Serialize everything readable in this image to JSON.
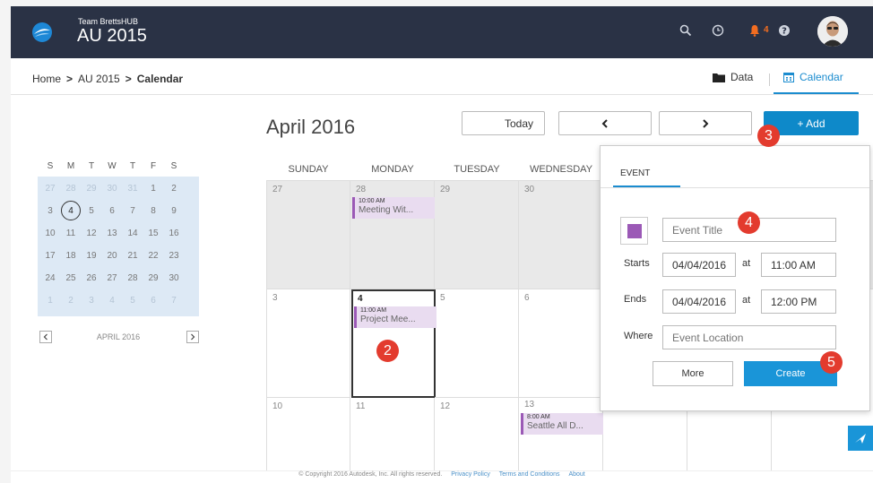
{
  "header": {
    "team": "Team BrettsHUB",
    "project": "AU 2015",
    "notification_count": "4"
  },
  "breadcrumb": {
    "items": [
      "Home",
      "AU 2015",
      "Calendar"
    ]
  },
  "view_tabs": [
    {
      "label": "Data",
      "active": false
    },
    {
      "label": "Calendar",
      "active": true
    }
  ],
  "calendar": {
    "month_title": "April 2016",
    "today_label": "Today",
    "add_label": "+ Add",
    "weekdays": [
      "SUNDAY",
      "MONDAY",
      "TUESDAY",
      "WEDNESDAY"
    ],
    "days": [
      "27",
      "28",
      "29",
      "30",
      "3",
      "4",
      "5",
      "6",
      "10",
      "11",
      "12",
      "13"
    ],
    "events": [
      {
        "time": "10:00 AM",
        "title": "Meeting Wit..."
      },
      {
        "time": "11:00 AM",
        "title": "Project Mee..."
      },
      {
        "time": "8:00 AM",
        "title": "Seattle All D..."
      }
    ]
  },
  "mini_calendar": {
    "weekdays": [
      "S",
      "M",
      "T",
      "W",
      "T",
      "F",
      "S"
    ],
    "weeks": [
      [
        "27",
        "28",
        "29",
        "30",
        "31",
        "1",
        "2"
      ],
      [
        "3",
        "4",
        "5",
        "6",
        "7",
        "8",
        "9"
      ],
      [
        "10",
        "11",
        "12",
        "13",
        "14",
        "15",
        "16"
      ],
      [
        "17",
        "18",
        "19",
        "20",
        "21",
        "22",
        "23"
      ],
      [
        "24",
        "25",
        "26",
        "27",
        "28",
        "29",
        "30"
      ],
      [
        "1",
        "2",
        "3",
        "4",
        "5",
        "6",
        "7"
      ]
    ],
    "label": "APRIL 2016"
  },
  "event_form": {
    "tab": "EVENT",
    "title_placeholder": "Event Title",
    "starts_label": "Starts",
    "start_date": "04/04/2016",
    "at_label": "at",
    "start_time": "11:00 AM",
    "ends_label": "Ends",
    "end_date": "04/04/2016",
    "end_time": "12:00 PM",
    "where_label": "Where",
    "location_placeholder": "Event Location",
    "more_label": "More",
    "create_label": "Create",
    "color": "#9b59b6"
  },
  "callouts": [
    "2",
    "3",
    "4",
    "5"
  ],
  "footer": {
    "copyright": "© Copyright 2016 Autodesk, Inc. All rights reserved.",
    "links": [
      "Privacy Policy",
      "Terms and Conditions",
      "About"
    ]
  },
  "colors": {
    "topbar": "#2a3245",
    "accent": "#0e89c9",
    "callout": "#e33b2e",
    "event": "#9b59b6"
  }
}
